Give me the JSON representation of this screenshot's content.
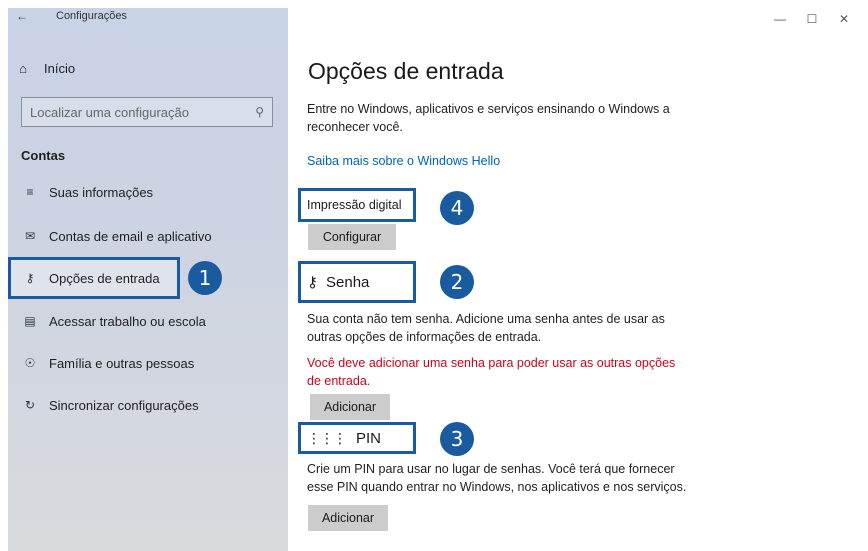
{
  "titlebar": {
    "app_title": "Configurações"
  },
  "sidebar": {
    "home_label": "Início",
    "search_placeholder": "Localizar uma configuração",
    "section_title": "Contas",
    "items": [
      {
        "label": "Suas informações",
        "icon": "person-info-icon"
      },
      {
        "label": "Contas de email e aplicativo",
        "icon": "mail-icon"
      },
      {
        "label": "Opções de entrada",
        "icon": "key-icon",
        "selected": true
      },
      {
        "label": "Acessar trabalho ou escola",
        "icon": "briefcase-icon"
      },
      {
        "label": "Família e outras pessoas",
        "icon": "person-add-icon"
      },
      {
        "label": "Sincronizar configurações",
        "icon": "sync-icon"
      }
    ]
  },
  "main": {
    "title": "Opções de entrada",
    "intro_line1": "Entre no Windows, aplicativos e serviços ensinando o Windows a",
    "intro_line2": "reconhecer você.",
    "hello_link": "Saiba mais sobre o Windows Hello",
    "fingerprint": {
      "title": "Impressão digital",
      "button": "Configurar"
    },
    "password": {
      "title": "Senha",
      "desc_line1": "Sua conta não tem senha. Adicione uma senha antes de usar as",
      "desc_line2": "outras opções de informações de entrada.",
      "error_line1": "Você deve adicionar uma senha para poder usar as outras opções",
      "error_line2": "de entrada.",
      "button": "Adicionar"
    },
    "pin": {
      "title": "PIN",
      "desc_line1": "Crie um PIN para usar no lugar de senhas. Você terá que fornecer",
      "desc_line2": "esse PIN quando entrar no Windows, nos aplicativos e nos serviços.",
      "button": "Adicionar"
    }
  },
  "badges": [
    "1",
    "2",
    "3",
    "4"
  ],
  "colors": {
    "accent": "#1a5a9e",
    "link": "#0063b1",
    "error": "#d0021b",
    "button": "#cccccc"
  }
}
